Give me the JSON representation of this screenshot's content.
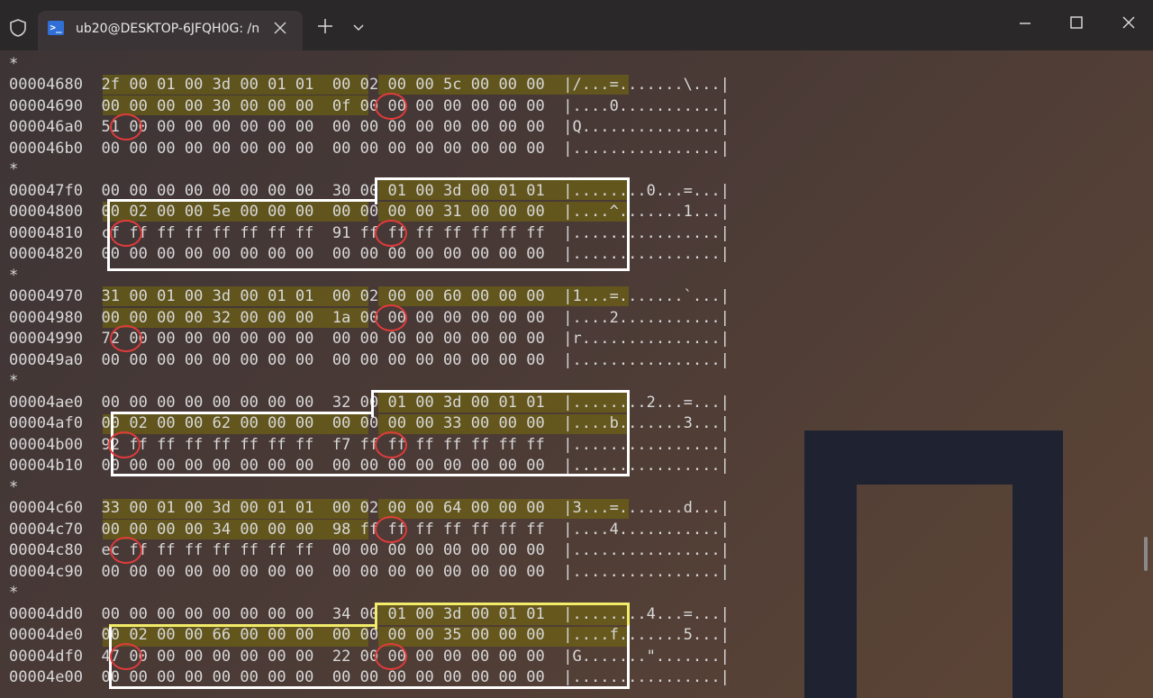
{
  "window": {
    "tab_title": "ub20@DESKTOP-6JFQH0G: /n",
    "ps_glyph": ">_"
  },
  "colors": {
    "highlight": "#e8e060",
    "ring": "#e03b3b",
    "frame_white": "#ffffff",
    "frame_yellow": "#f2ec6a"
  },
  "icons": [
    "shield-icon",
    "powershell-icon",
    "close-icon",
    "plus-icon",
    "chevron-down-icon",
    "minimize-icon",
    "maximize-icon",
    "window-close-icon"
  ],
  "hexdump": {
    "lines": [
      "*",
      "00004680  2f 00 01 00 3d 00 01 01  00 02 00 00 5c 00 00 00  |/...=.......\\...|",
      "00004690  00 00 00 00 30 00 00 00  0f 00 00 00 00 00 00 00  |....0...........|",
      "000046a0  51 00 00 00 00 00 00 00  00 00 00 00 00 00 00 00  |Q...............|",
      "000046b0  00 00 00 00 00 00 00 00  00 00 00 00 00 00 00 00  |................|",
      "*",
      "000047f0  00 00 00 00 00 00 00 00  30 00 01 00 3d 00 01 01  |........0...=...|",
      "00004800  00 02 00 00 5e 00 00 00  00 00 00 00 31 00 00 00  |....^.......1...|",
      "00004810  cf ff ff ff ff ff ff ff  91 ff ff ff ff ff ff ff  |................|",
      "00004820  00 00 00 00 00 00 00 00  00 00 00 00 00 00 00 00  |................|",
      "*",
      "00004970  31 00 01 00 3d 00 01 01  00 02 00 00 60 00 00 00  |1...=.......`...|",
      "00004980  00 00 00 00 32 00 00 00  1a 00 00 00 00 00 00 00  |....2...........|",
      "00004990  72 00 00 00 00 00 00 00  00 00 00 00 00 00 00 00  |r...............|",
      "000049a0  00 00 00 00 00 00 00 00  00 00 00 00 00 00 00 00  |................|",
      "*",
      "00004ae0  00 00 00 00 00 00 00 00  32 00 01 00 3d 00 01 01  |........2...=...|",
      "00004af0  00 02 00 00 62 00 00 00  00 00 00 00 33 00 00 00  |....b.......3...|",
      "00004b00  92 ff ff ff ff ff ff ff  f7 ff ff ff ff ff ff ff  |................|",
      "00004b10  00 00 00 00 00 00 00 00  00 00 00 00 00 00 00 00  |................|",
      "*",
      "00004c60  33 00 01 00 3d 00 01 01  00 02 00 00 64 00 00 00  |3...=.......d...|",
      "00004c70  00 00 00 00 34 00 00 00  98 ff ff ff ff ff ff ff  |....4...........|",
      "00004c80  ec ff ff ff ff ff ff ff  00 00 00 00 00 00 00 00  |................|",
      "00004c90  00 00 00 00 00 00 00 00  00 00 00 00 00 00 00 00  |................|",
      "*",
      "00004dd0  00 00 00 00 00 00 00 00  34 00 01 00 3d 00 01 01  |........4...=...|",
      "00004de0  00 02 00 00 66 00 00 00  00 00 00 00 35 00 00 00  |....f.......5...|",
      "00004df0  47 00 00 00 00 00 00 00  22 00 00 00 00 00 00 00  |G.......\".......|",
      "00004e00  00 00 00 00 00 00 00 00  00 00 00 00 00 00 00 00  |................|"
    ]
  }
}
